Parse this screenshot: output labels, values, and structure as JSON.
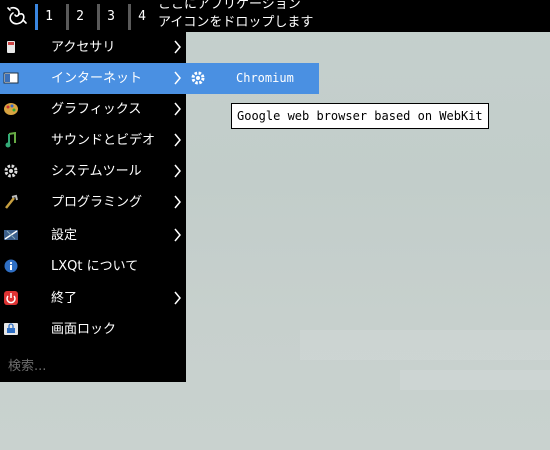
{
  "panel": {
    "workspaces": [
      "1",
      "2",
      "3",
      "4"
    ],
    "quicklaunch_hint": [
      "ここにアプリケーション",
      "アイコンをドロップします"
    ]
  },
  "menu": {
    "items": [
      {
        "label": "アクセサリ",
        "icon": "accessories-icon",
        "submenu": true
      },
      {
        "label": "インターネット",
        "icon": "internet-icon",
        "submenu": true,
        "highlighted": true
      },
      {
        "label": "グラフィックス",
        "icon": "graphics-icon",
        "submenu": true
      },
      {
        "label": "サウンドとビデオ",
        "icon": "sound-video-icon",
        "submenu": true
      },
      {
        "label": "システムツール",
        "icon": "system-tools-icon",
        "submenu": true
      },
      {
        "label": "プログラミング",
        "icon": "programming-icon",
        "submenu": true
      },
      {
        "label": "設定",
        "icon": "settings-icon",
        "submenu": true
      },
      {
        "label": "LXQt について",
        "icon": "about-icon",
        "submenu": false
      },
      {
        "label": "終了",
        "icon": "power-icon",
        "submenu": true
      },
      {
        "label": "画面ロック",
        "icon": "lock-icon",
        "submenu": false
      }
    ],
    "search_placeholder": "検索..."
  },
  "submenu": {
    "items": [
      {
        "label": "Chromium",
        "icon": "chromium-gear-icon"
      }
    ]
  },
  "tooltip": {
    "text": "Google web browser based on WebKit"
  },
  "colors": {
    "highlight": "#4a90e2",
    "panel": "#000000",
    "desktop": "#c5d0cd"
  }
}
